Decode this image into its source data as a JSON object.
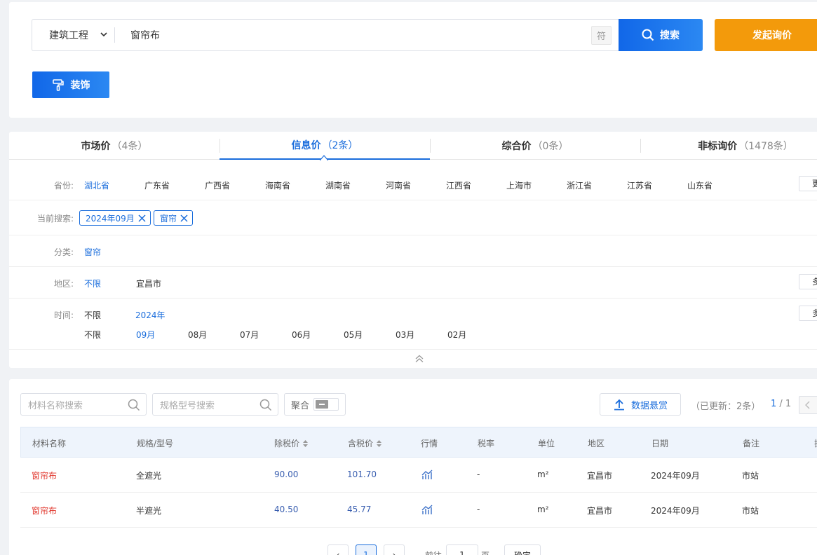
{
  "search": {
    "category": "建筑工程",
    "query": "窗帘布",
    "symbol_button": "符",
    "search_button": "搜索",
    "inquiry_button": "发起询价",
    "tag_button": "装饰"
  },
  "tabs": [
    {
      "label": "市场价",
      "count": "（4条）"
    },
    {
      "label": "信息价",
      "count": "（2条）"
    },
    {
      "label": "综合价",
      "count": "（0条）"
    },
    {
      "label": "非标询价",
      "count": "（1478条）"
    }
  ],
  "filters": {
    "province_label": "省份:",
    "provinces": [
      "湖北省",
      "广东省",
      "广西省",
      "海南省",
      "湖南省",
      "河南省",
      "江西省",
      "上海市",
      "浙江省",
      "江苏省",
      "山东省"
    ],
    "province_more": "更",
    "current_label": "当前搜索:",
    "current_tags": [
      "2024年09月",
      "窗帘"
    ],
    "category_label": "分类:",
    "category_value": "窗帘",
    "region_label": "地区:",
    "region_any": "不限",
    "region_city": "宜昌市",
    "region_more": "多",
    "time_label": "时间:",
    "time_year_any": "不限",
    "time_year": "2024年",
    "time_more": "多",
    "time_month_any": "不限",
    "months": [
      "09月",
      "08月",
      "07月",
      "06月",
      "05月",
      "03月",
      "02月"
    ]
  },
  "table": {
    "name_search_placeholder": "材料名称搜索",
    "spec_search_placeholder": "规格型号搜索",
    "aggregate_label": "聚合",
    "reward_button": "数据悬赏",
    "updated_text": "（已更新：2条）",
    "page_current": "1",
    "page_total": " / 1",
    "columns": [
      "材料名称",
      "规格/型号",
      "除税价",
      "含税价",
      "行情",
      "税率",
      "单位",
      "地区",
      "日期",
      "备注",
      "操"
    ],
    "rows": [
      {
        "name": "窗帘布",
        "spec": "全遮光",
        "price_ex": "90.00",
        "price_in": "101.70",
        "tax": "-",
        "unit": "m²",
        "region": "宜昌市",
        "date": "2024年09月",
        "note": "市站"
      },
      {
        "name": "窗帘布",
        "spec": "半遮光",
        "price_ex": "40.50",
        "price_in": "45.77",
        "tax": "-",
        "unit": "m²",
        "region": "宜昌市",
        "date": "2024年09月",
        "note": "市站"
      }
    ]
  },
  "pagination": {
    "prev": "‹",
    "current": "1",
    "next": "›",
    "goto_label": "前往",
    "goto_value": "1",
    "page_label": "页",
    "confirm": "确定"
  },
  "colors": {
    "primary": "#1a6ddc",
    "orange": "#f39a0b",
    "red": "#e0352b"
  }
}
